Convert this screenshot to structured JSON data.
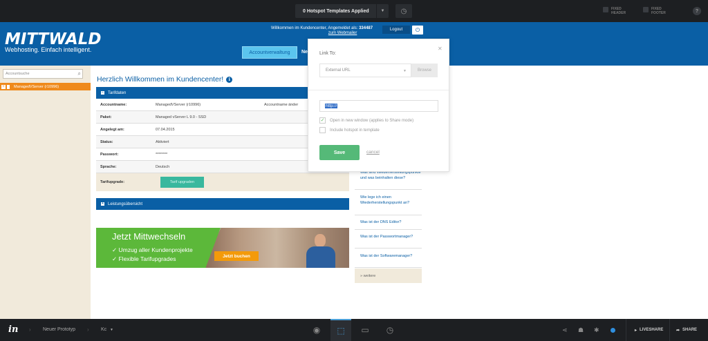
{
  "topbar": {
    "hotspot_select": "0 Hotspot Templates Applied",
    "fixed_header": [
      "FIXED",
      "HEADER"
    ],
    "fixed_footer": [
      "FIXED",
      "FOOTER"
    ],
    "help": "?"
  },
  "header": {
    "logo": "MITTWALD",
    "tagline": "Webhosting. Einfach intelligent.",
    "welcome_text": "Willkommen im Kundencenter, Angemeldet als:",
    "user_id": "334487",
    "webmailer_link": "zum Webmailer",
    "logout": "Logout",
    "nav_active": "Accountverwaltung",
    "nav_next": "Ne"
  },
  "sidebar": {
    "search_placeholder": "Accountsuche",
    "tree_item": "ManagedVServer (r10996)"
  },
  "main": {
    "title": "Herzlich Willkommen im Kundencenter!",
    "tarifdaten_header": "Tarifdaten",
    "rows": [
      {
        "key": "Accountname:",
        "value": "ManagedVServer (r10996)",
        "extra": "Accountname änder"
      },
      {
        "key": "Paket:",
        "value": "Managed vServer L 9.0 - SSD",
        "extra": ""
      },
      {
        "key": "Angelegt am:",
        "value": "07.04.2015",
        "extra": ""
      },
      {
        "key": "Status:",
        "value": "Aktiviert",
        "extra": ""
      },
      {
        "key": "Passwort:",
        "value": "********",
        "extra": ""
      },
      {
        "key": "Sprache:",
        "value": "Deutsch",
        "extra": ""
      }
    ],
    "tarifupgrade_label": "Tarifupgrade:",
    "tarif_button": "Tarif upgraden",
    "leistung_header": "Leistungsübersicht"
  },
  "banner": {
    "title": "Jetzt Mittwechseln",
    "items": [
      "✓ Umzug aller Kundenprojekte",
      "✓ Flexible Tarifupgrades"
    ],
    "cta": "Jetzt buchen"
  },
  "faq": {
    "items": [
      "Was sind Wiederherstellungspunkte und was beinhalten diese?",
      "Wie lege ich einen Wiederherstellungspunkt an?",
      "Was ist der DNS Editor?",
      "Was ist der Passwortmanager?",
      "Was ist der Softwaremanager?"
    ],
    "more": "» weitere"
  },
  "popover": {
    "label": "Link To:",
    "select_value": "External URL",
    "browse": "Browse",
    "url_value": "http://",
    "option_new_window": "Open in new window (applies to Share mode)",
    "option_template": "Include hotspot in template",
    "new_window_checked": true,
    "template_checked": false,
    "save": "Save",
    "cancel": "cancel"
  },
  "bottombar": {
    "logo": "in",
    "project": "Neuer Prototyp",
    "screen": "Kc",
    "liveshare": "LIVESHARE",
    "share": "SHARE"
  }
}
